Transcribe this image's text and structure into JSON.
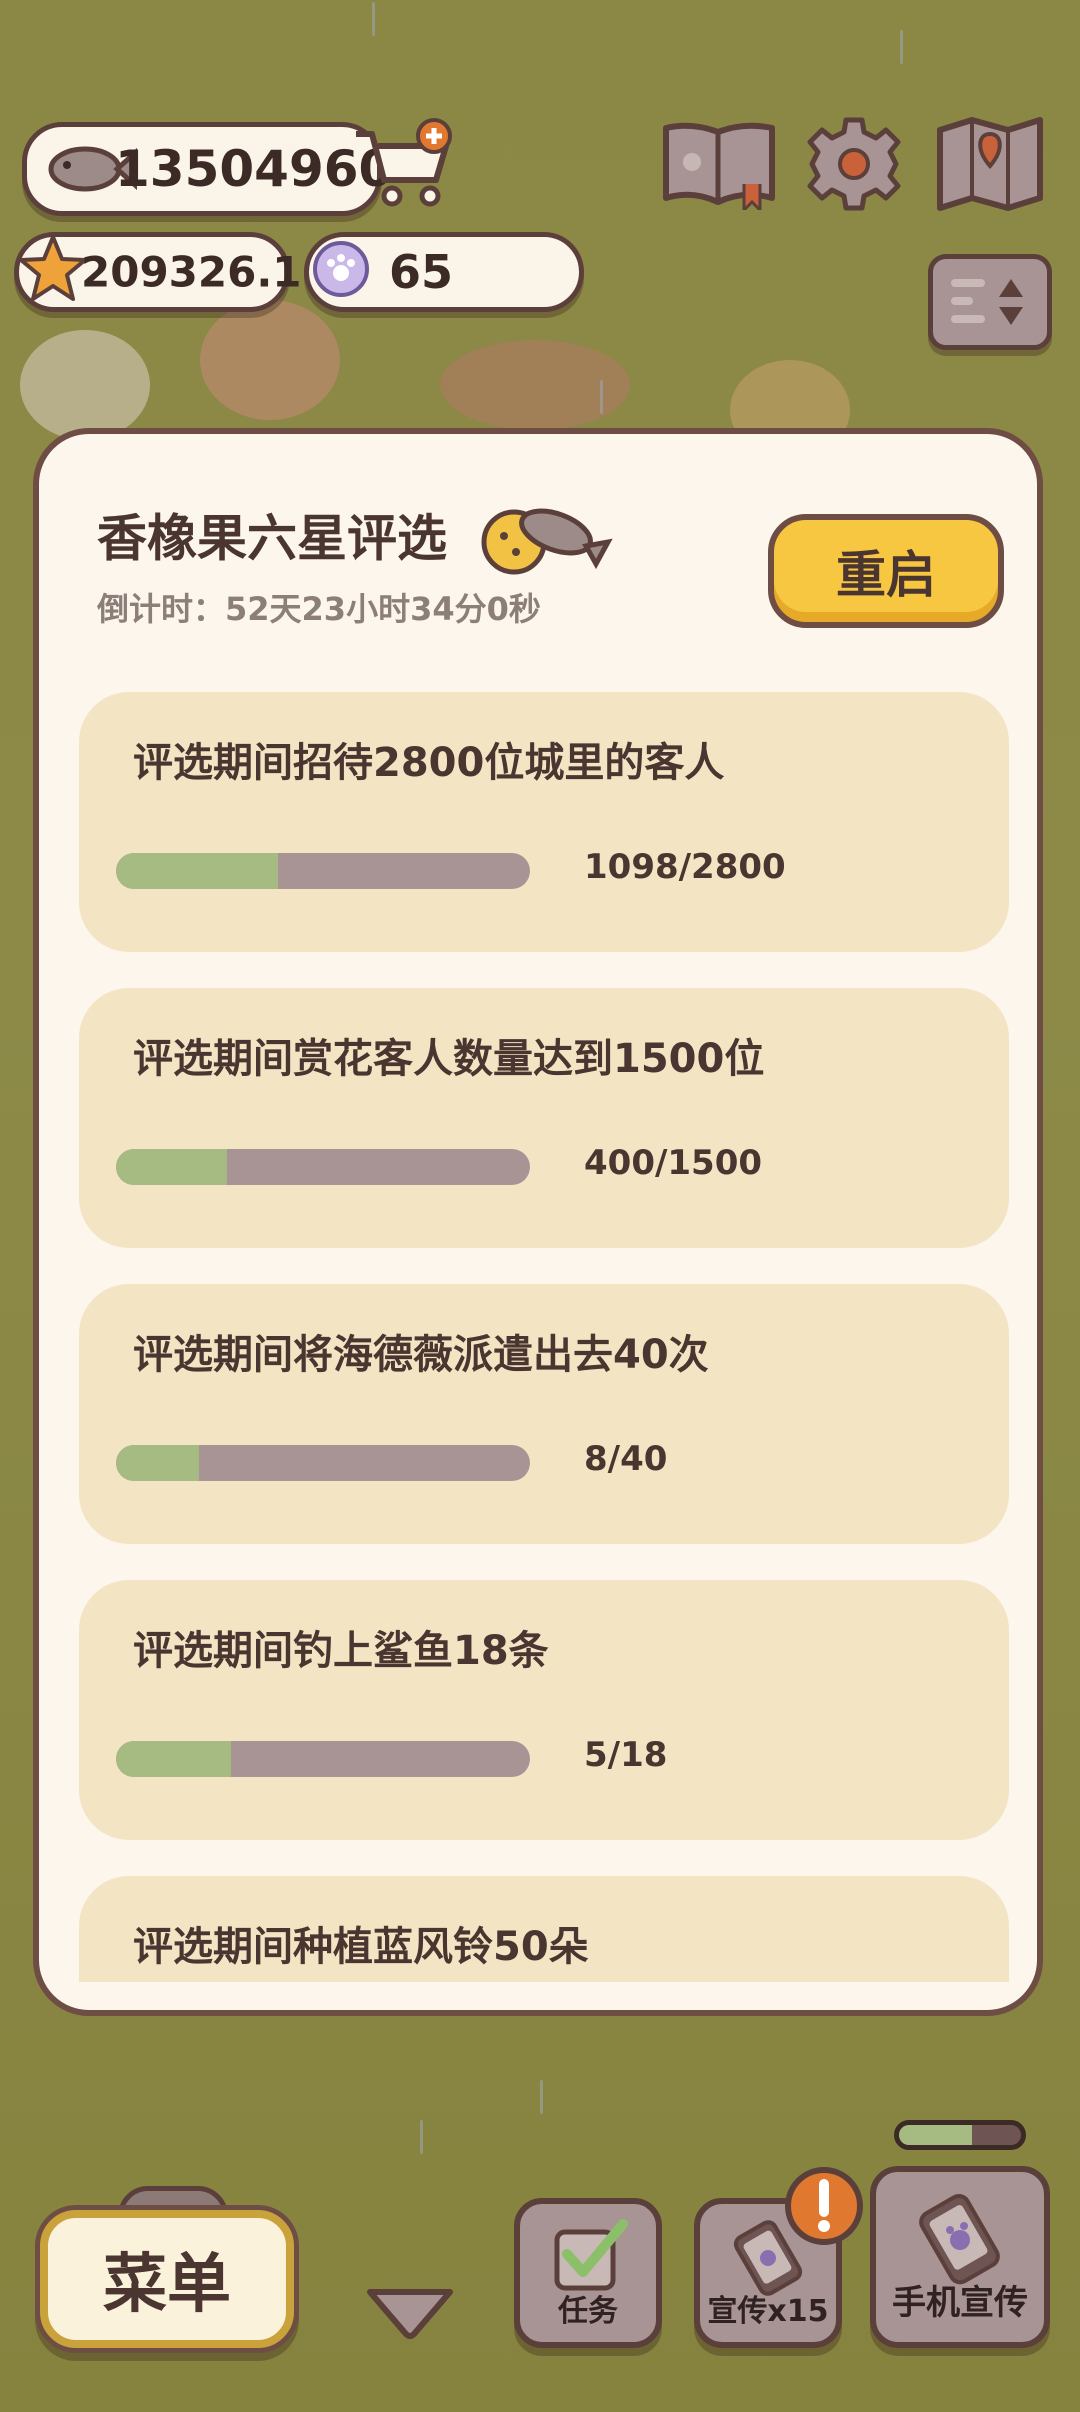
{
  "hud": {
    "fish_count": "13504960",
    "star_count": "209326.1",
    "paw_count": "65"
  },
  "modal": {
    "title": "香橡果六星评选",
    "countdown": "倒计时：52天23小时34分0秒",
    "restart_label": "重启",
    "tasks": [
      {
        "label": "评选期间招待2800位城里的客人",
        "count": "1098/2800",
        "progress": 0.392
      },
      {
        "label": "评选期间赏花客人数量达到1500位",
        "count": "400/1500",
        "progress": 0.267
      },
      {
        "label": "评选期间将海德薇派遣出去40次",
        "count": "8/40",
        "progress": 0.2
      },
      {
        "label": "评选期间钓上鲨鱼18条",
        "count": "5/18",
        "progress": 0.278
      },
      {
        "label": "评选期间种植蓝风铃50朵",
        "count": "",
        "progress": 0
      }
    ]
  },
  "bottom": {
    "menu_label": "菜单",
    "tasks_label": "任务",
    "promo_label": "宣传x15",
    "phone_promo_label": "手机宣传",
    "phone_promo_progress": 0.6
  },
  "colors": {
    "accent_yellow": "#f7c741",
    "progress_green": "#a6bb82",
    "progress_track": "#a89494",
    "card_bg": "#f3e5c4",
    "alert_orange": "#e0782f"
  }
}
